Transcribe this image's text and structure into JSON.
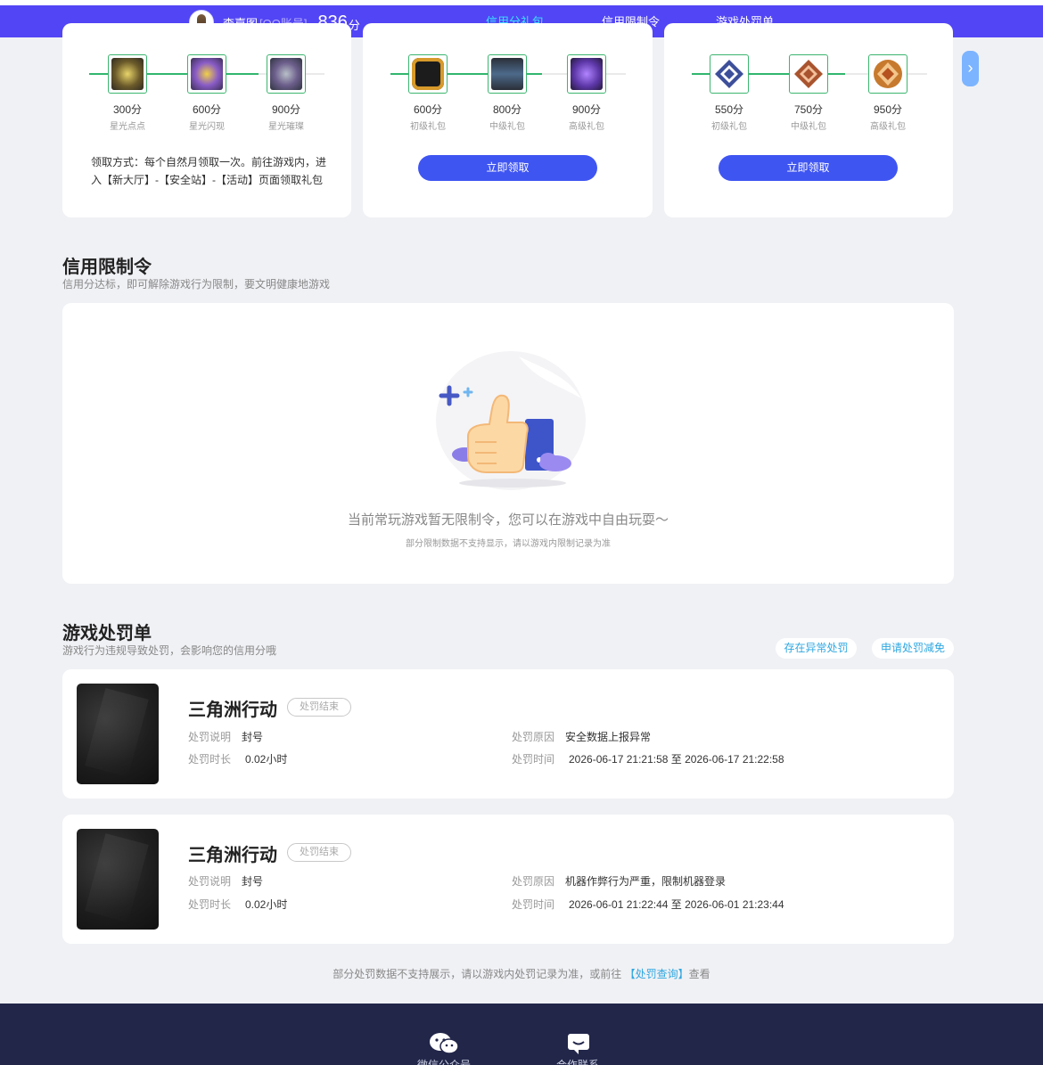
{
  "header": {
    "user_name": "李嘉图",
    "account_type": "[QQ账号]",
    "score": "836",
    "score_unit": "分",
    "tabs": [
      {
        "label": "信用分礼包",
        "active": true
      },
      {
        "label": "信用限制令",
        "active": false
      },
      {
        "label": "游戏处罚单",
        "active": false
      }
    ]
  },
  "gift_cards": [
    {
      "items": [
        {
          "points": "300分",
          "name": "星光点点"
        },
        {
          "points": "600分",
          "name": "星光闪现"
        },
        {
          "points": "900分",
          "name": "星光璀璨"
        }
      ],
      "claim_note": "领取方式：每个自然月领取一次。前往游戏内，进入【新大厅】-【安全站】-【活动】页面领取礼包"
    },
    {
      "items": [
        {
          "points": "600分",
          "name": "初级礼包"
        },
        {
          "points": "800分",
          "name": "中级礼包"
        },
        {
          "points": "900分",
          "name": "高级礼包"
        }
      ],
      "button": "立即领取"
    },
    {
      "items": [
        {
          "points": "550分",
          "name": "初级礼包"
        },
        {
          "points": "750分",
          "name": "中级礼包"
        },
        {
          "points": "950分",
          "name": "高级礼包"
        }
      ],
      "button": "立即领取"
    }
  ],
  "restriction": {
    "title": "信用限制令",
    "subtitle": "信用分达标，即可解除游戏行为限制，要文明健康地游戏",
    "empty_main": "当前常玩游戏暂无限制令，您可以在游戏中自由玩耍～",
    "empty_sub": "部分限制数据不支持显示，请以游戏内限制记录为准"
  },
  "penalty": {
    "title": "游戏处罚单",
    "subtitle": "游戏行为违规导致处罚，会影响您的信用分哦",
    "btn_abnormal": "存在异常处罚",
    "btn_appeal": "申请处罚减免",
    "labels": {
      "desc": "处罚说明",
      "duration": "处罚时长",
      "reason": "处罚原因",
      "time": "处罚时间"
    },
    "records": [
      {
        "game": "三角洲行动",
        "status": "处罚结束",
        "desc": "封号",
        "duration": "0.02小时",
        "reason": "安全数据上报异常",
        "time": "2026-06-17 21:21:58 至 2026-06-17 21:22:58"
      },
      {
        "game": "三角洲行动",
        "status": "处罚结束",
        "desc": "封号",
        "duration": "0.02小时",
        "reason": "机器作弊行为严重，限制机器登录",
        "time": "2026-06-01 21:22:44 至 2026-06-01 21:23:44"
      }
    ],
    "footnote_before": "部分处罚数据不支持展示，请以游戏内处罚记录为准，或前往",
    "footnote_link": "【处罚查询】",
    "footnote_after": "查看"
  },
  "footer": {
    "items": [
      {
        "label": "微信公众号",
        "icon": "wechat-icon"
      },
      {
        "label": "合作联系",
        "icon": "chat-icon"
      }
    ]
  },
  "colors": {
    "nav_bg": "#5245f5",
    "active_tab": "#39e4ff",
    "progress": "#32b66e",
    "button": "#3f55f2",
    "footer_bg": "#222649",
    "link": "#2fa7e0"
  }
}
